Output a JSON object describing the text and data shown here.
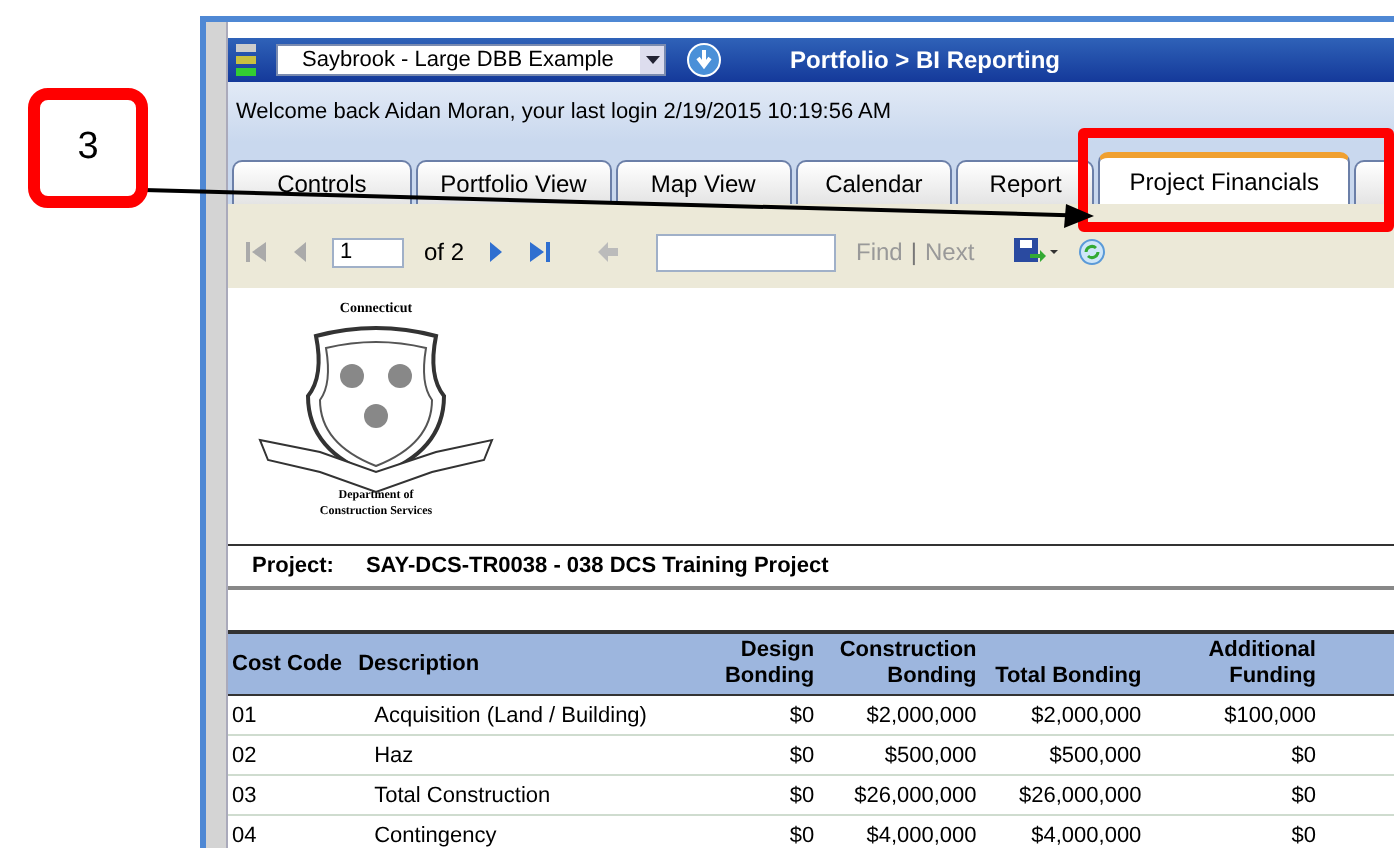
{
  "callout": {
    "number": "3"
  },
  "window": {
    "project_selector": "Saybrook - Large DBB Example",
    "breadcrumb": "Portfolio > BI Reporting",
    "welcome": "Welcome back  Aidan Moran, your last login 2/19/2015 10:19:56 AM"
  },
  "tabs": [
    {
      "label": "Controls",
      "selected": false
    },
    {
      "label": "Portfolio View",
      "selected": false
    },
    {
      "label": "Map View",
      "selected": false
    },
    {
      "label": "Calendar",
      "selected": false
    },
    {
      "label": "Report",
      "selected": false
    },
    {
      "label": "Project Financials",
      "selected": true
    }
  ],
  "toolbar": {
    "page": "1",
    "page_count": "of 2",
    "find": "Find",
    "separator": "|",
    "next": "Next"
  },
  "report": {
    "logo": {
      "top": "Connecticut",
      "bottom": [
        "Department of",
        "Construction Services"
      ]
    },
    "project_label": "Project:",
    "project": "SAY-DCS-TR0038 - 038 DCS Training Project",
    "table": {
      "columns": [
        "Cost Code",
        "Description",
        "Design Bonding",
        "Construction Bonding",
        "Total Bonding",
        "Additional Funding"
      ],
      "rows": [
        [
          "01",
          "Acquisition (Land / Building)",
          "$0",
          "$2,000,000",
          "$2,000,000",
          "$100,000"
        ],
        [
          "02",
          "Haz",
          "$0",
          "$500,000",
          "$500,000",
          "$0"
        ],
        [
          "03",
          "Total Construction",
          "$0",
          "$26,000,000",
          "$26,000,000",
          "$0"
        ],
        [
          "04",
          "Contingency",
          "$0",
          "$4,000,000",
          "$4,000,000",
          "$0"
        ]
      ]
    }
  }
}
